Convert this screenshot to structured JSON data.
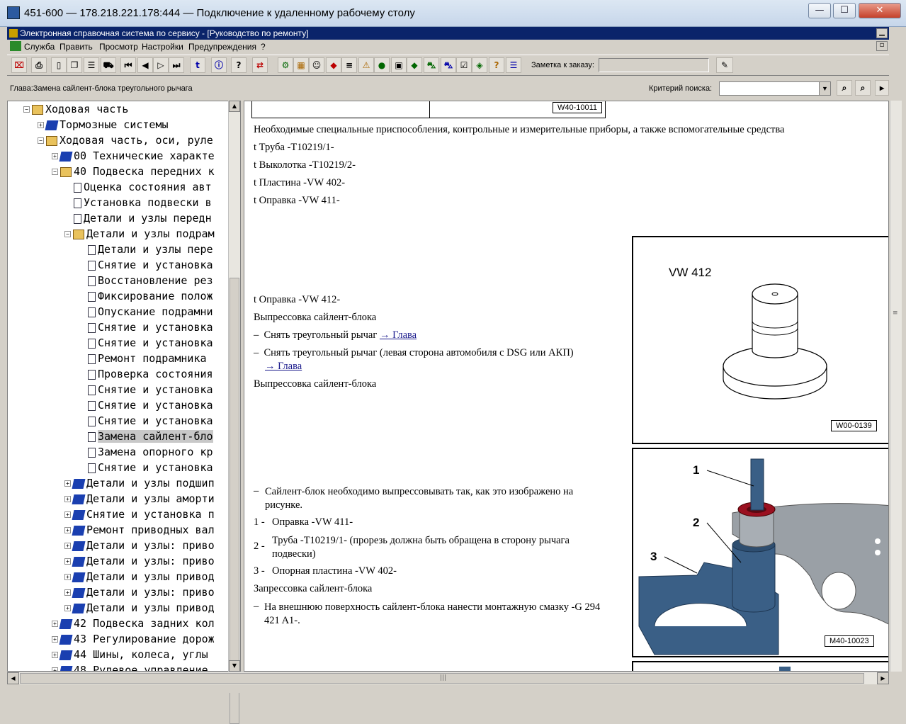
{
  "window": {
    "title": "451-600 — 178.218.221.178:444 — Подключение к удаленному рабочему столу",
    "min": "—",
    "max": "☐",
    "close": "✕"
  },
  "app": {
    "title": "Электронная справочная система по сервису - [Руководство по ремонту]"
  },
  "menu": [
    "Служба",
    "Править",
    "Просмотр",
    "Настройки",
    "Предупреждения",
    "?"
  ],
  "toolbar": {
    "note_label": "Заметка к заказу:",
    "note_value": ""
  },
  "chapter_bar": {
    "chapter": "Глава:Замена сайлент-блока треугольного рычага",
    "search_label": "Критерий поиска:",
    "search_value": ""
  },
  "tree": [
    {
      "label": "Ходовая часть",
      "icon": "open",
      "exp": "−",
      "indent": 0
    },
    {
      "label": "Тормозные системы",
      "icon": "closed",
      "exp": "+",
      "indent": 1
    },
    {
      "label": "Ходовая часть, оси, руле",
      "icon": "open",
      "exp": "−",
      "indent": 1
    },
    {
      "label": "00 Технические характе",
      "icon": "closed",
      "exp": "+",
      "indent": 2
    },
    {
      "label": "40 Подвеска передних к",
      "icon": "open",
      "exp": "−",
      "indent": 2
    },
    {
      "label": "Оценка состояния авт",
      "icon": "page",
      "exp": "",
      "indent": 3
    },
    {
      "label": "Установка подвески в",
      "icon": "page",
      "exp": "",
      "indent": 3
    },
    {
      "label": "Детали и узлы передн",
      "icon": "page",
      "exp": "",
      "indent": 3
    },
    {
      "label": "Детали и узлы подрам",
      "icon": "open",
      "exp": "−",
      "indent": 3
    },
    {
      "label": "Детали и узлы пере",
      "icon": "page",
      "exp": "",
      "indent": 4
    },
    {
      "label": "Снятие и установка",
      "icon": "page",
      "exp": "",
      "indent": 4
    },
    {
      "label": "Восстановление рез",
      "icon": "page",
      "exp": "",
      "indent": 4
    },
    {
      "label": "Фиксирование полож",
      "icon": "page",
      "exp": "",
      "indent": 4
    },
    {
      "label": "Опускание подрамни",
      "icon": "page",
      "exp": "",
      "indent": 4
    },
    {
      "label": "Снятие и установка",
      "icon": "page",
      "exp": "",
      "indent": 4
    },
    {
      "label": "Снятие и установка",
      "icon": "page",
      "exp": "",
      "indent": 4
    },
    {
      "label": "Ремонт подрамника",
      "icon": "page",
      "exp": "",
      "indent": 4
    },
    {
      "label": "Проверка состояния",
      "icon": "page",
      "exp": "",
      "indent": 4
    },
    {
      "label": "Снятие и установка",
      "icon": "page",
      "exp": "",
      "indent": 4
    },
    {
      "label": "Снятие и установка",
      "icon": "page",
      "exp": "",
      "indent": 4
    },
    {
      "label": "Снятие и установка",
      "icon": "page",
      "exp": "",
      "indent": 4
    },
    {
      "label": "Замена сайлент-бло",
      "icon": "page",
      "exp": "",
      "indent": 4,
      "selected": true
    },
    {
      "label": "Замена опорного кр",
      "icon": "page",
      "exp": "",
      "indent": 4
    },
    {
      "label": "Снятие и установка",
      "icon": "page",
      "exp": "",
      "indent": 4
    },
    {
      "label": "Детали и узлы подшип",
      "icon": "closed",
      "exp": "+",
      "indent": 3
    },
    {
      "label": "Детали и узлы аморти",
      "icon": "closed",
      "exp": "+",
      "indent": 3
    },
    {
      "label": "Снятие и установка п",
      "icon": "closed",
      "exp": "+",
      "indent": 3
    },
    {
      "label": "Ремонт приводных вал",
      "icon": "closed",
      "exp": "+",
      "indent": 3
    },
    {
      "label": "Детали и узлы: приво",
      "icon": "closed",
      "exp": "+",
      "indent": 3
    },
    {
      "label": "Детали и узлы: приво",
      "icon": "closed",
      "exp": "+",
      "indent": 3
    },
    {
      "label": "Детали и узлы привод",
      "icon": "closed",
      "exp": "+",
      "indent": 3
    },
    {
      "label": "Детали и узлы: приво",
      "icon": "closed",
      "exp": "+",
      "indent": 3
    },
    {
      "label": "Детали и узлы привод",
      "icon": "closed",
      "exp": "+",
      "indent": 3
    },
    {
      "label": "42 Подвеска задних кол",
      "icon": "closed",
      "exp": "+",
      "indent": 2
    },
    {
      "label": "43 Регулирование дорож",
      "icon": "closed",
      "exp": "+",
      "indent": 2
    },
    {
      "label": "44 Шины, колеса, углы",
      "icon": "closed",
      "exp": "+",
      "indent": 2
    },
    {
      "label": "48 Рулевое управление",
      "icon": "closed",
      "exp": "+",
      "indent": 2
    }
  ],
  "content": {
    "top_label": "W40-10011",
    "tools_heading": "Необходимые специальные приспособления, контрольные и измерительные приборы, а также вспомогательные средства",
    "tools": [
      "t  Труба -T10219/1-",
      "t  Выколотка -T10219/2-",
      "t  Пластина -VW 402-",
      "t  Оправка -VW 411-"
    ],
    "tool_412": "t  Оправка -VW 412-",
    "press_out_heading": "Выпрессовка сайлент-блока",
    "step1_text": "Снять треугольный рычаг",
    "step1_link": "→ Глава",
    "step2_text": "Снять треугольный рычаг (левая сторона автомобиля с DSG или АКП)",
    "step2_link": "→ Глава",
    "press_out_heading2": "Выпрессовка сайлент-блока",
    "fig1_title": "VW  412",
    "fig1_label": "W00-0139",
    "note": "Сайлент-блок необходимо выпрессовывать так, как это изображено на рисунке.",
    "items": [
      {
        "num": "1 -",
        "text": "Оправка -VW 411-"
      },
      {
        "num": "2 -",
        "text": "Труба -T10219/1- (прорезь должна быть обращена в сторону рычага подвески)"
      },
      {
        "num": "3 -",
        "text": "Опорная пластина -VW 402-"
      }
    ],
    "press_in_heading": "Запрессовка сайлент-блока",
    "press_in_step": "На внешнюю поверхность сайлент-блока нанести монтажную смазку -G 294 421 A1-.",
    "fig2_callouts": [
      "1",
      "2",
      "3"
    ],
    "fig2_label": "M40-10023",
    "dash": "–"
  },
  "colors": {
    "app_title_bg": "#0a246a",
    "link": "#1a1a8c",
    "tool_blue": "#3a5f86",
    "bushing_red": "#9a1020"
  }
}
